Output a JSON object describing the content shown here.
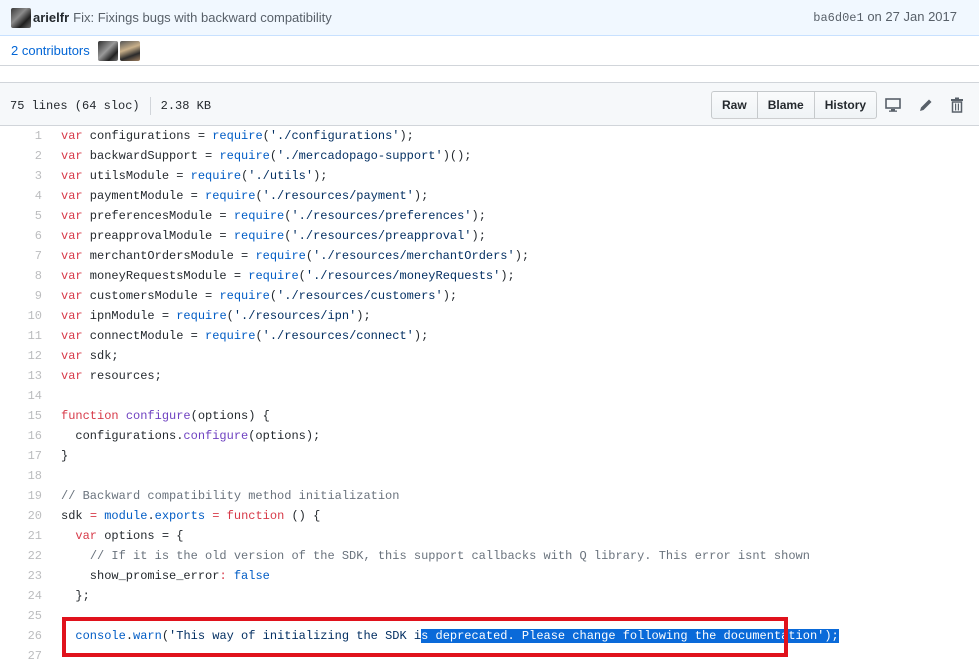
{
  "commit": {
    "author": "arielfr",
    "message": "Fix: Fixings bugs with backward compatibility",
    "sha": "ba6d0e1",
    "date_prefix": "on",
    "date": "27 Jan 2017"
  },
  "contributors": {
    "label": "2 contributors"
  },
  "file": {
    "lines_info": "75 lines (64 sloc)",
    "size": "2.38 KB",
    "buttons": {
      "raw": "Raw",
      "blame": "Blame",
      "history": "History"
    },
    "icons": [
      "desktop-icon",
      "pencil-icon",
      "trash-icon"
    ]
  },
  "code": [
    {
      "n": "1",
      "tokens": [
        [
          "k",
          "var"
        ],
        [
          "p",
          " configurations = "
        ],
        [
          "b",
          "require"
        ],
        [
          "p",
          "("
        ],
        [
          "s",
          "'./configurations'"
        ],
        [
          "p",
          ");"
        ]
      ]
    },
    {
      "n": "2",
      "tokens": [
        [
          "k",
          "var"
        ],
        [
          "p",
          " backwardSupport = "
        ],
        [
          "b",
          "require"
        ],
        [
          "p",
          "("
        ],
        [
          "s",
          "'./mercadopago-support'"
        ],
        [
          "p",
          ")();"
        ]
      ]
    },
    {
      "n": "3",
      "tokens": [
        [
          "k",
          "var"
        ],
        [
          "p",
          " utilsModule = "
        ],
        [
          "b",
          "require"
        ],
        [
          "p",
          "("
        ],
        [
          "s",
          "'./utils'"
        ],
        [
          "p",
          ");"
        ]
      ]
    },
    {
      "n": "4",
      "tokens": [
        [
          "k",
          "var"
        ],
        [
          "p",
          " paymentModule = "
        ],
        [
          "b",
          "require"
        ],
        [
          "p",
          "("
        ],
        [
          "s",
          "'./resources/payment'"
        ],
        [
          "p",
          ");"
        ]
      ]
    },
    {
      "n": "5",
      "tokens": [
        [
          "k",
          "var"
        ],
        [
          "p",
          " preferencesModule = "
        ],
        [
          "b",
          "require"
        ],
        [
          "p",
          "("
        ],
        [
          "s",
          "'./resources/preferences'"
        ],
        [
          "p",
          ");"
        ]
      ]
    },
    {
      "n": "6",
      "tokens": [
        [
          "k",
          "var"
        ],
        [
          "p",
          " preapprovalModule = "
        ],
        [
          "b",
          "require"
        ],
        [
          "p",
          "("
        ],
        [
          "s",
          "'./resources/preapproval'"
        ],
        [
          "p",
          ");"
        ]
      ]
    },
    {
      "n": "7",
      "tokens": [
        [
          "k",
          "var"
        ],
        [
          "p",
          " merchantOrdersModule = "
        ],
        [
          "b",
          "require"
        ],
        [
          "p",
          "("
        ],
        [
          "s",
          "'./resources/merchantOrders'"
        ],
        [
          "p",
          ");"
        ]
      ]
    },
    {
      "n": "8",
      "tokens": [
        [
          "k",
          "var"
        ],
        [
          "p",
          " moneyRequestsModule = "
        ],
        [
          "b",
          "require"
        ],
        [
          "p",
          "("
        ],
        [
          "s",
          "'./resources/moneyRequests'"
        ],
        [
          "p",
          ");"
        ]
      ]
    },
    {
      "n": "9",
      "tokens": [
        [
          "k",
          "var"
        ],
        [
          "p",
          " customersModule = "
        ],
        [
          "b",
          "require"
        ],
        [
          "p",
          "("
        ],
        [
          "s",
          "'./resources/customers'"
        ],
        [
          "p",
          ");"
        ]
      ]
    },
    {
      "n": "10",
      "tokens": [
        [
          "k",
          "var"
        ],
        [
          "p",
          " ipnModule = "
        ],
        [
          "b",
          "require"
        ],
        [
          "p",
          "("
        ],
        [
          "s",
          "'./resources/ipn'"
        ],
        [
          "p",
          ");"
        ]
      ]
    },
    {
      "n": "11",
      "tokens": [
        [
          "k",
          "var"
        ],
        [
          "p",
          " connectModule = "
        ],
        [
          "b",
          "require"
        ],
        [
          "p",
          "("
        ],
        [
          "s",
          "'./resources/connect'"
        ],
        [
          "p",
          ");"
        ]
      ]
    },
    {
      "n": "12",
      "tokens": [
        [
          "k",
          "var"
        ],
        [
          "p",
          " sdk;"
        ]
      ]
    },
    {
      "n": "13",
      "tokens": [
        [
          "k",
          "var"
        ],
        [
          "p",
          " resources;"
        ]
      ]
    },
    {
      "n": "14",
      "tokens": []
    },
    {
      "n": "15",
      "tokens": [
        [
          "k",
          "function"
        ],
        [
          "p",
          " "
        ],
        [
          "f",
          "configure"
        ],
        [
          "p",
          "(options) {"
        ]
      ]
    },
    {
      "n": "16",
      "tokens": [
        [
          "p",
          "  configurations."
        ],
        [
          "f",
          "configure"
        ],
        [
          "p",
          "(options);"
        ]
      ]
    },
    {
      "n": "17",
      "tokens": [
        [
          "p",
          "}"
        ]
      ]
    },
    {
      "n": "18",
      "tokens": []
    },
    {
      "n": "19",
      "tokens": [
        [
          "c",
          "// Backward compatibility method initialization"
        ]
      ]
    },
    {
      "n": "20",
      "tokens": [
        [
          "p",
          "sdk "
        ],
        [
          "k",
          "="
        ],
        [
          "p",
          " "
        ],
        [
          "b",
          "module"
        ],
        [
          "p",
          "."
        ],
        [
          "b",
          "exports"
        ],
        [
          "p",
          " "
        ],
        [
          "k",
          "="
        ],
        [
          "p",
          " "
        ],
        [
          "k",
          "function"
        ],
        [
          "p",
          " () {"
        ]
      ]
    },
    {
      "n": "21",
      "tokens": [
        [
          "p",
          "  "
        ],
        [
          "k",
          "var"
        ],
        [
          "p",
          " options = {"
        ]
      ]
    },
    {
      "n": "22",
      "tokens": [
        [
          "p",
          "    "
        ],
        [
          "c",
          "// If it is the old version of the SDK, this support callbacks with Q library. This error isnt shown"
        ]
      ]
    },
    {
      "n": "23",
      "tokens": [
        [
          "p",
          "    show_promise_error"
        ],
        [
          "k",
          ":"
        ],
        [
          "p",
          " "
        ],
        [
          "b",
          "false"
        ]
      ]
    },
    {
      "n": "24",
      "tokens": [
        [
          "p",
          "  };"
        ]
      ]
    },
    {
      "n": "25",
      "tokens": []
    },
    {
      "n": "26",
      "tokens": [
        [
          "p",
          "  "
        ],
        [
          "b",
          "console"
        ],
        [
          "p",
          "."
        ],
        [
          "b",
          "warn"
        ],
        [
          "p",
          "("
        ],
        [
          "s",
          "'This way of initializing the SDK i"
        ],
        [
          "sel",
          "s deprecated. Please change following the documentation'"
        ],
        [
          "sel",
          ");"
        ]
      ]
    },
    {
      "n": "27",
      "tokens": []
    }
  ]
}
